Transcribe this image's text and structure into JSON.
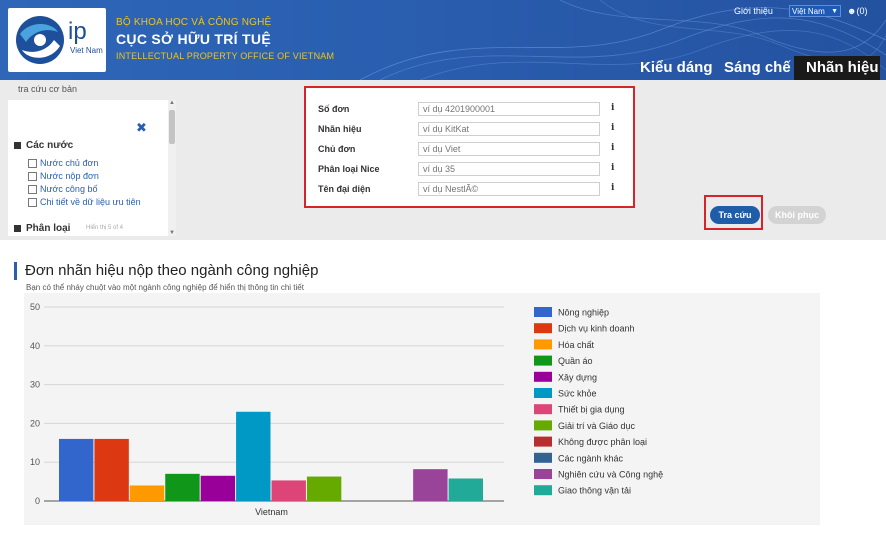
{
  "header": {
    "ministry": "BỘ KHOA HỌC VÀ CÔNG NGHỆ",
    "office_name": "CỤC SỞ HỮU TRÍ TUỆ",
    "office_name_en": "INTELLECTUAL PROPERTY OFFICE OF VIETNAM",
    "logo_text": "ip",
    "logo_subtext": "Viet Nam",
    "intro_link": "Giới thiệu",
    "language": "Việt Nam",
    "user_link": "(0)",
    "tabs": [
      {
        "label": "Kiểu dáng"
      },
      {
        "label": "Sáng chế"
      },
      {
        "label": "Nhãn hiệu"
      }
    ]
  },
  "search": {
    "basic_search": "tra cứu cơ bản",
    "filters": {
      "countries_title": "Các nước",
      "countries_options": [
        "Nước chủ đơn",
        "Nước nộp đơn",
        "Nước công bố",
        "Chi tiết về dữ liệu ưu tiên"
      ],
      "class_title": "Phân loại",
      "class_hint": "Hiển thị 5 of 4"
    },
    "fields": [
      {
        "label": "Số đơn",
        "placeholder": "ví dụ 4201900001"
      },
      {
        "label": "Nhãn hiệu",
        "placeholder": "ví dụ KitKat"
      },
      {
        "label": "Chủ đơn",
        "placeholder": "ví dụ Viet"
      },
      {
        "label": "Phân loại Nice",
        "placeholder": "ví dụ 35"
      },
      {
        "label": "Tên đại diện",
        "placeholder": "ví dụ NestlÃ©"
      }
    ],
    "info_symbol": "i",
    "search_button": "Tra cứu",
    "reset_button": "Khôi phục"
  },
  "chart_section": {
    "heading": "Đơn nhãn hiệu nộp theo ngành công nghiệp",
    "subtitle": "Bạn có thể nháy chuột vào một ngành công nghiệp để hiển thị thông tin chi tiết"
  },
  "chart_data": {
    "type": "bar",
    "categories": [
      "Vietnam"
    ],
    "ylim": [
      0,
      50
    ],
    "yticks": [
      0,
      10,
      20,
      30,
      40,
      50
    ],
    "grid": true,
    "legend_position": "right",
    "series": [
      {
        "name": "Nông nghiệp",
        "values": [
          16
        ],
        "color": "#3366cc"
      },
      {
        "name": "Dịch vụ kinh doanh",
        "values": [
          16
        ],
        "color": "#dc3912"
      },
      {
        "name": "Hóa chất",
        "values": [
          4
        ],
        "color": "#ff9900"
      },
      {
        "name": "Quần áo",
        "values": [
          7
        ],
        "color": "#109618"
      },
      {
        "name": "Xây dựng",
        "values": [
          6.5
        ],
        "color": "#990099"
      },
      {
        "name": "Sức khỏe",
        "values": [
          23
        ],
        "color": "#0099c6"
      },
      {
        "name": "Thiết bị gia dụng",
        "values": [
          5.3
        ],
        "color": "#dd4477"
      },
      {
        "name": "Giải trí và Giáo dục",
        "values": [
          6.3
        ],
        "color": "#66aa00"
      },
      {
        "name": "Không được phân loại",
        "values": [
          0
        ],
        "color": "#b82e2e"
      },
      {
        "name": "Các ngành khác",
        "values": [
          0
        ],
        "color": "#316395"
      },
      {
        "name": "Nghiên cứu và Công nghệ",
        "values": [
          8.2
        ],
        "color": "#994499"
      },
      {
        "name": "Giao thông vận tải",
        "values": [
          5.8
        ],
        "color": "#22aa99"
      }
    ]
  }
}
